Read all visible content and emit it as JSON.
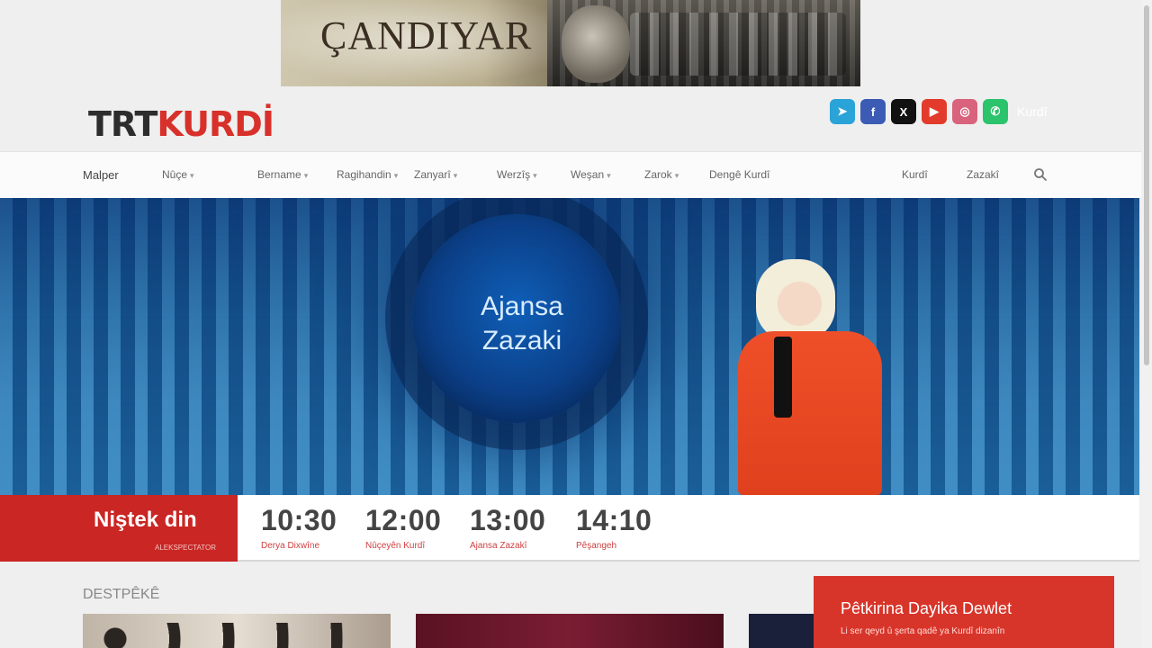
{
  "ad": {
    "title": "ÇANDIYAR"
  },
  "header": {
    "logo_trt": "TRT",
    "logo_kurdi": "KURDİ",
    "language": "Kurdî",
    "socials": [
      {
        "icon": "telegram-icon",
        "glyph": "➤",
        "color": "#2aa3d8"
      },
      {
        "icon": "facebook-icon",
        "glyph": "f",
        "color": "#3b5bb5"
      },
      {
        "icon": "x-icon",
        "glyph": "X",
        "color": "#111111"
      },
      {
        "icon": "youtube-icon",
        "glyph": "▶",
        "color": "#e33b2b"
      },
      {
        "icon": "instagram-icon",
        "glyph": "◎",
        "color": "#d9627d"
      },
      {
        "icon": "whatsapp-icon",
        "glyph": "✆",
        "color": "#2bc36b"
      }
    ]
  },
  "nav": {
    "items": [
      {
        "label": "Malper",
        "has_menu": false,
        "active": true
      },
      {
        "label": "Nûçe",
        "has_menu": true
      },
      {
        "label": "Bername",
        "has_menu": true
      },
      {
        "label": "Ragihandin",
        "has_menu": true
      },
      {
        "label": "Zanyarî",
        "has_menu": true
      },
      {
        "label": "Werzîş",
        "has_menu": true
      },
      {
        "label": "Weşan",
        "has_menu": true
      },
      {
        "label": "Zarok",
        "has_menu": true
      },
      {
        "label": "Dengê Kurdî",
        "has_menu": false
      },
      {
        "label": "Kurdî",
        "has_menu": false
      },
      {
        "label": "Zazakî",
        "has_menu": false
      }
    ]
  },
  "hero": {
    "show_title_line1": "Ajansa",
    "show_title_line2": "Zazaki"
  },
  "schedule": {
    "live_title": "Niştek din",
    "live_sub": "ALEKSPECTATOR",
    "slots": [
      {
        "time": "10:30",
        "program": "Derya Dixwîne"
      },
      {
        "time": "12:00",
        "program": "Nûçeyên Kurdî"
      },
      {
        "time": "13:00",
        "program": "Ajansa Zazakî"
      },
      {
        "time": "14:10",
        "program": "Pêşangeh"
      }
    ]
  },
  "content": {
    "section_label": "DESTPÊKÊ",
    "promo_title": "Pêtkirina Dayika Dewlet",
    "promo_sub": "Li ser qeyd û şerta qadê ya Kurdî dizanîn"
  }
}
